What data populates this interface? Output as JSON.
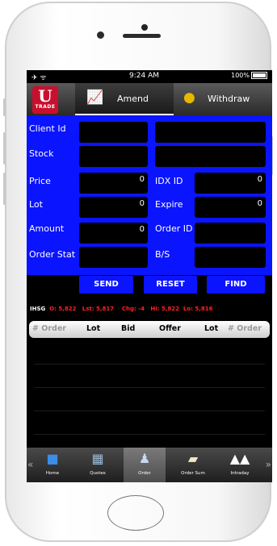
{
  "status_bar": {
    "signal": "✈ ᯤ",
    "time": "9:24 AM",
    "battery": "100%"
  },
  "header": {
    "logo_letter": "U",
    "logo_text": "TRADE",
    "tabs": [
      {
        "label": "Amend",
        "icon": "chart-person-icon"
      },
      {
        "label": "Withdraw",
        "icon": "coins-icon"
      }
    ]
  },
  "form": {
    "client_id_label": "Client Id",
    "stock_label": "Stock",
    "price_label": "Price",
    "price_value": "0",
    "idx_id_label": "IDX ID",
    "idx_id_value": "0",
    "lot_label": "Lot",
    "lot_value": "0",
    "expire_label": "Expire",
    "expire_value": "0",
    "amount_label": "Amount",
    "amount_value": "0",
    "order_id_label": "Order ID",
    "order_stat_label": "Order Stat",
    "bs_label": "B/S"
  },
  "actions": {
    "send": "SEND",
    "reset": "RESET",
    "find": "FIND"
  },
  "ihsg": {
    "label": "IHSG",
    "open": "O: 5,822",
    "last": "Lst: 5,817",
    "change": "Chg: -4",
    "high": "Hi: 5,822",
    "low": "Lo: 5,816"
  },
  "table_headers": [
    "# Order",
    "Lot",
    "Bid",
    "Offer",
    "Lot",
    "# Order"
  ],
  "bottom_nav": [
    {
      "label": "Home",
      "icon": "briefcase-icon"
    },
    {
      "label": "Quotes",
      "icon": "quotes-icon"
    },
    {
      "label": "Order",
      "icon": "order-icon"
    },
    {
      "label": "Order Sum",
      "icon": "book-icon"
    },
    {
      "label": "Intraday",
      "icon": "arrows-up-icon"
    }
  ],
  "colors": {
    "form_bg": "#0b14ff",
    "logo": "#c8102e",
    "ticker_red": "#ff2222"
  }
}
